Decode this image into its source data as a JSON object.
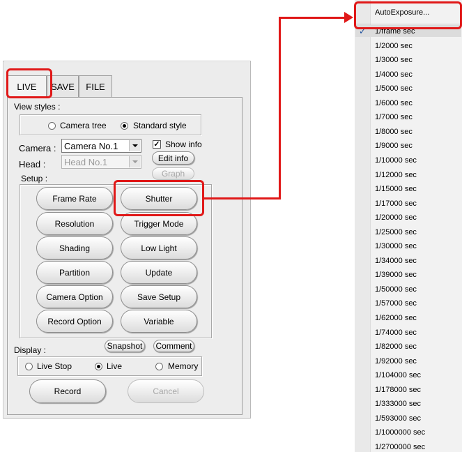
{
  "tabs": [
    "LIVE",
    "SAVE",
    "FILE"
  ],
  "view_styles": {
    "label": "View styles :",
    "options": [
      "Camera tree",
      "Standard style"
    ],
    "selected": "Standard style"
  },
  "camera": {
    "label": "Camera :",
    "value": "Camera No.1",
    "head_label": "Head :",
    "head_value": "Head No.1",
    "show_info_label": "Show info",
    "show_info_checked": "✓",
    "edit_info": "Edit info",
    "graph": "Graph"
  },
  "setup": {
    "label": "Setup :",
    "buttons": [
      "Frame Rate",
      "Shutter",
      "Resolution",
      "Trigger Mode",
      "Shading",
      "Low Light",
      "Partition",
      "Update",
      "Camera Option",
      "Save Setup",
      "Record Option",
      "Variable"
    ]
  },
  "display": {
    "label": "Display :",
    "snapshot": "Snapshot",
    "comment": "Comment",
    "options": [
      "Live Stop",
      "Live",
      "Memory"
    ],
    "selected": "Live"
  },
  "actions": {
    "record": "Record",
    "cancel": "Cancel"
  },
  "shutter_menu": {
    "header": "AutoExposure...",
    "checkmark": "✓",
    "checked_item": "1/frame sec",
    "items": [
      "1/frame sec",
      "1/2000 sec",
      "1/3000 sec",
      "1/4000 sec",
      "1/5000 sec",
      "1/6000 sec",
      "1/7000 sec",
      "1/8000 sec",
      "1/9000 sec",
      "1/10000 sec",
      "1/12000 sec",
      "1/15000 sec",
      "1/17000 sec",
      "1/20000 sec",
      "1/25000 sec",
      "1/30000 sec",
      "1/34000 sec",
      "1/39000 sec",
      "1/50000 sec",
      "1/57000 sec",
      "1/62000 sec",
      "1/74000 sec",
      "1/82000 sec",
      "1/92000 sec",
      "1/104000 sec",
      "1/178000 sec",
      "1/333000 sec",
      "1/593000 sec",
      "1/1000000 sec",
      "1/2700000 sec"
    ]
  },
  "colors": {
    "highlight": "#e01818",
    "panel": "#ececec",
    "menu": "#f2f2f2"
  }
}
